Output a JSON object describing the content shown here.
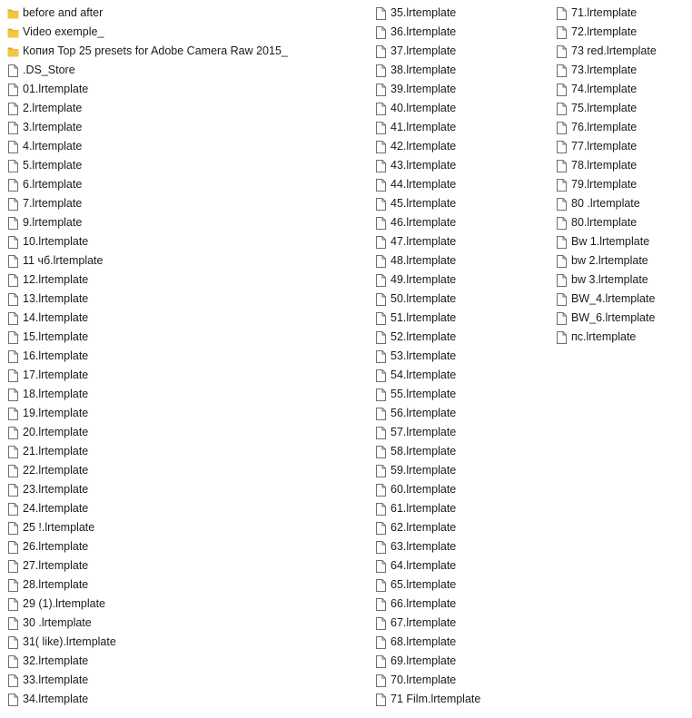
{
  "columns": [
    {
      "items": [
        {
          "type": "folder",
          "name": "before and after"
        },
        {
          "type": "folder",
          "name": "Video exemple_"
        },
        {
          "type": "folder",
          "name": "Копия Top 25 presets for Adobe Camera Raw 2015_"
        },
        {
          "type": "file",
          "name": ".DS_Store"
        },
        {
          "type": "file",
          "name": "01.lrtemplate"
        },
        {
          "type": "file",
          "name": "2.lrtemplate"
        },
        {
          "type": "file",
          "name": "3.lrtemplate"
        },
        {
          "type": "file",
          "name": "4.lrtemplate"
        },
        {
          "type": "file",
          "name": "5.lrtemplate"
        },
        {
          "type": "file",
          "name": "6.lrtemplate"
        },
        {
          "type": "file",
          "name": "7.lrtemplate"
        },
        {
          "type": "file",
          "name": "9.lrtemplate"
        },
        {
          "type": "file",
          "name": "10.lrtemplate"
        },
        {
          "type": "file",
          "name": "11 чб.lrtemplate"
        },
        {
          "type": "file",
          "name": "12.lrtemplate"
        },
        {
          "type": "file",
          "name": "13.lrtemplate"
        },
        {
          "type": "file",
          "name": "14.lrtemplate"
        },
        {
          "type": "file",
          "name": "15.lrtemplate"
        },
        {
          "type": "file",
          "name": "16.lrtemplate"
        },
        {
          "type": "file",
          "name": "17.lrtemplate"
        },
        {
          "type": "file",
          "name": "18.lrtemplate"
        },
        {
          "type": "file",
          "name": "19.lrtemplate"
        },
        {
          "type": "file",
          "name": "20.lrtemplate"
        },
        {
          "type": "file",
          "name": "21.lrtemplate"
        },
        {
          "type": "file",
          "name": "22.lrtemplate"
        },
        {
          "type": "file",
          "name": "23.lrtemplate"
        },
        {
          "type": "file",
          "name": "24.lrtemplate"
        },
        {
          "type": "file",
          "name": "25 !.lrtemplate"
        },
        {
          "type": "file",
          "name": "26.lrtemplate"
        },
        {
          "type": "file",
          "name": "27.lrtemplate"
        },
        {
          "type": "file",
          "name": "28.lrtemplate"
        },
        {
          "type": "file",
          "name": "29 (1).lrtemplate"
        },
        {
          "type": "file",
          "name": "30 .lrtemplate"
        },
        {
          "type": "file",
          "name": "31( like).lrtemplate"
        },
        {
          "type": "file",
          "name": "32.lrtemplate"
        },
        {
          "type": "file",
          "name": "33.lrtemplate"
        },
        {
          "type": "file",
          "name": "34.lrtemplate"
        }
      ]
    },
    {
      "items": [
        {
          "type": "file",
          "name": "35.lrtemplate"
        },
        {
          "type": "file",
          "name": "36.lrtemplate"
        },
        {
          "type": "file",
          "name": "37.lrtemplate"
        },
        {
          "type": "file",
          "name": "38.lrtemplate"
        },
        {
          "type": "file",
          "name": "39.lrtemplate"
        },
        {
          "type": "file",
          "name": "40.lrtemplate"
        },
        {
          "type": "file",
          "name": "41.lrtemplate"
        },
        {
          "type": "file",
          "name": "42.lrtemplate"
        },
        {
          "type": "file",
          "name": "43.lrtemplate"
        },
        {
          "type": "file",
          "name": "44.lrtemplate"
        },
        {
          "type": "file",
          "name": "45.lrtemplate"
        },
        {
          "type": "file",
          "name": "46.lrtemplate"
        },
        {
          "type": "file",
          "name": "47.lrtemplate"
        },
        {
          "type": "file",
          "name": "48.lrtemplate"
        },
        {
          "type": "file",
          "name": "49.lrtemplate"
        },
        {
          "type": "file",
          "name": "50.lrtemplate"
        },
        {
          "type": "file",
          "name": "51.lrtemplate"
        },
        {
          "type": "file",
          "name": "52.lrtemplate"
        },
        {
          "type": "file",
          "name": "53.lrtemplate"
        },
        {
          "type": "file",
          "name": "54.lrtemplate"
        },
        {
          "type": "file",
          "name": "55.lrtemplate"
        },
        {
          "type": "file",
          "name": "56.lrtemplate"
        },
        {
          "type": "file",
          "name": "57.lrtemplate"
        },
        {
          "type": "file",
          "name": "58.lrtemplate"
        },
        {
          "type": "file",
          "name": "59.lrtemplate"
        },
        {
          "type": "file",
          "name": "60.lrtemplate"
        },
        {
          "type": "file",
          "name": "61.lrtemplate"
        },
        {
          "type": "file",
          "name": "62.lrtemplate"
        },
        {
          "type": "file",
          "name": "63.lrtemplate"
        },
        {
          "type": "file",
          "name": "64.lrtemplate"
        },
        {
          "type": "file",
          "name": "65.lrtemplate"
        },
        {
          "type": "file",
          "name": "66.lrtemplate"
        },
        {
          "type": "file",
          "name": "67.lrtemplate"
        },
        {
          "type": "file",
          "name": "68.lrtemplate"
        },
        {
          "type": "file",
          "name": "69.lrtemplate"
        },
        {
          "type": "file",
          "name": "70.lrtemplate"
        },
        {
          "type": "file",
          "name": "71 Film.lrtemplate"
        }
      ]
    },
    {
      "items": [
        {
          "type": "file",
          "name": "71.lrtemplate"
        },
        {
          "type": "file",
          "name": "72.lrtemplate"
        },
        {
          "type": "file",
          "name": "73 red.lrtemplate"
        },
        {
          "type": "file",
          "name": "73.lrtemplate"
        },
        {
          "type": "file",
          "name": "74.lrtemplate"
        },
        {
          "type": "file",
          "name": "75.lrtemplate"
        },
        {
          "type": "file",
          "name": "76.lrtemplate"
        },
        {
          "type": "file",
          "name": "77.lrtemplate"
        },
        {
          "type": "file",
          "name": "78.lrtemplate"
        },
        {
          "type": "file",
          "name": "79.lrtemplate"
        },
        {
          "type": "file",
          "name": "80 .lrtemplate"
        },
        {
          "type": "file",
          "name": "80.lrtemplate"
        },
        {
          "type": "file",
          "name": "Bw 1.lrtemplate"
        },
        {
          "type": "file",
          "name": "bw 2.lrtemplate"
        },
        {
          "type": "file",
          "name": "bw 3.lrtemplate"
        },
        {
          "type": "file",
          "name": "BW_4.lrtemplate"
        },
        {
          "type": "file",
          "name": "BW_6.lrtemplate"
        },
        {
          "type": "file",
          "name": "пс.lrtemplate"
        }
      ]
    }
  ],
  "colors": {
    "folder_fill": "#f5c542",
    "folder_tab": "#e0a92a",
    "file_stroke": "#6e6e6e",
    "text": "#1a1a1a"
  },
  "icons": {
    "folder": "folder-icon",
    "file": "file-icon"
  }
}
